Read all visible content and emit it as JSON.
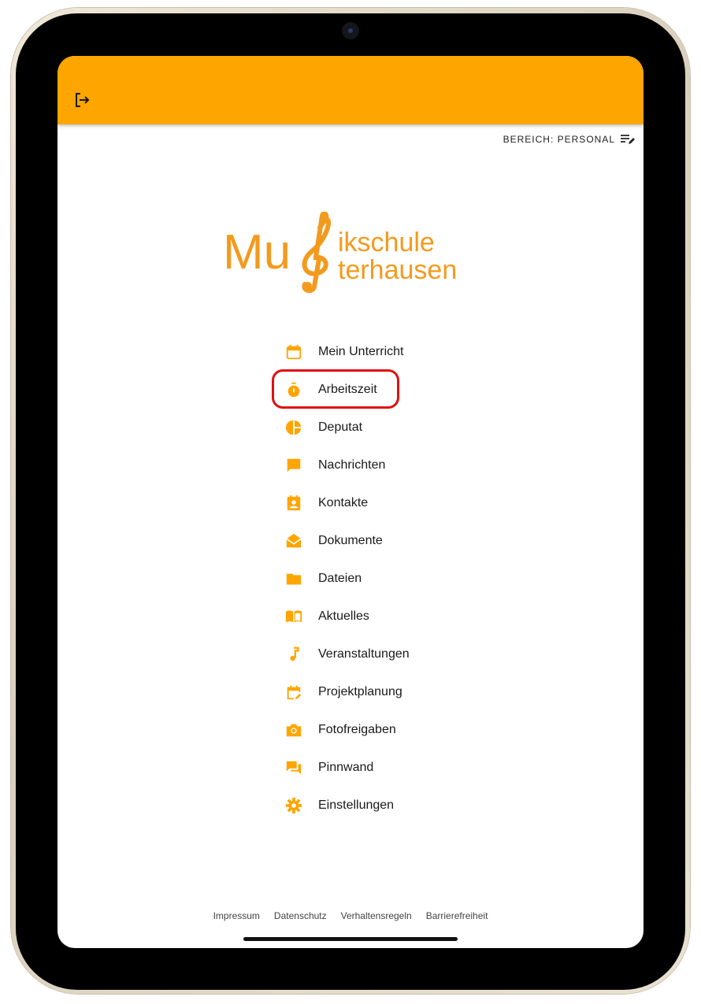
{
  "area": {
    "label": "BEREICH: PERSONAL",
    "icon": "edit-list-icon"
  },
  "logo": {
    "line1_a": "Mu",
    "line1_b": "ikschule",
    "line2_b": "terhausen",
    "color": "#f39a1e"
  },
  "accent": "#ffa500",
  "menu": {
    "items": [
      {
        "label": "Mein Unterricht",
        "icon": "calendar-icon"
      },
      {
        "label": "Arbeitszeit",
        "icon": "stopwatch-icon"
      },
      {
        "label": "Deputat",
        "icon": "pie-chart-icon"
      },
      {
        "label": "Nachrichten",
        "icon": "chat-bubble-icon"
      },
      {
        "label": "Kontakte",
        "icon": "contact-icon"
      },
      {
        "label": "Dokumente",
        "icon": "open-mail-icon"
      },
      {
        "label": "Dateien",
        "icon": "folder-icon"
      },
      {
        "label": "Aktuelles",
        "icon": "book-icon"
      },
      {
        "label": "Veranstaltungen",
        "icon": "music-note-icon"
      },
      {
        "label": "Projektplanung",
        "icon": "calendar-edit-icon"
      },
      {
        "label": "Fotofreigaben",
        "icon": "camera-icon"
      },
      {
        "label": "Pinnwand",
        "icon": "forum-icon"
      },
      {
        "label": "Einstellungen",
        "icon": "gear-icon"
      }
    ]
  },
  "footer": {
    "links": [
      "Impressum",
      "Datenschutz",
      "Verhaltensregeln",
      "Barrierefreiheit"
    ]
  }
}
